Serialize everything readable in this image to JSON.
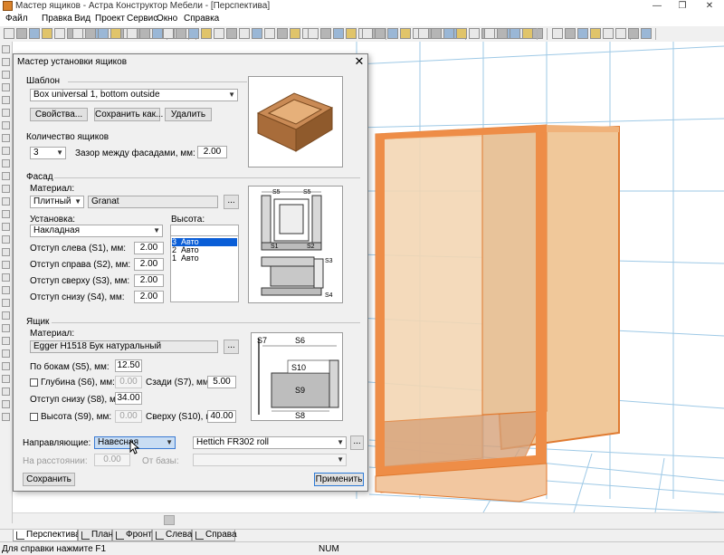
{
  "window": {
    "title": "Мастер ящиков - Астра Конструктор Мебели - [Перспектива]"
  },
  "menu": [
    "Файл",
    "Правка",
    "Вид",
    "Проект",
    "Сервис",
    "Окно",
    "Справка"
  ],
  "dialog": {
    "title": "Мастер установки ящиков",
    "template": {
      "section": "Шаблон",
      "selected": "Box universal 1, bottom outside",
      "properties_btn": "Свойства...",
      "save_as_btn": "Сохранить как...",
      "delete_btn": "Удалить"
    },
    "count": {
      "section": "Количество ящиков",
      "value": "3",
      "gap_label": "Зазор между фасадами, мм:",
      "gap_value": "2.00"
    },
    "facade": {
      "section": "Фасад",
      "material_label": "Материал:",
      "material_type": "Плитный",
      "material_name": "Granat",
      "mount_label": "Установка:",
      "mount_value": "Накладная",
      "height_label": "Высота:",
      "heights": [
        {
          "num": "3",
          "value": "Авто"
        },
        {
          "num": "2",
          "value": "Авто"
        },
        {
          "num": "1",
          "value": "Авто"
        }
      ],
      "s1_label": "Отступ слева (S1), мм:",
      "s1_value": "2.00",
      "s2_label": "Отступ справа (S2), мм:",
      "s2_value": "2.00",
      "s3_label": "Отступ сверху (S3), мм:",
      "s3_value": "2.00",
      "s4_label": "Отступ снизу (S4), мм:",
      "s4_value": "2.00",
      "diagram": {
        "s5a": "S5",
        "s5b": "S5",
        "s1": "S1",
        "s2": "S2",
        "s3": "S3",
        "s4": "S4"
      }
    },
    "box": {
      "section": "Ящик",
      "material_label": "Материал:",
      "material_value": "Egger H1518 Бук натуральный",
      "s5_label": "По бокам (S5), мм:",
      "s5_value": "12.50",
      "s6_label": "Глубина (S6), мм:",
      "s6_value": "0.00",
      "s7_label": "Сзади (S7), мм:",
      "s7_value": "5.00",
      "s8_label": "Отступ снизу (S8), мм:",
      "s8_value": "34.00",
      "s9_label": "Высота (S9), мм:",
      "s9_value": "0.00",
      "s10_label": "Сверху (S10), мм:",
      "s10_value": "40.00",
      "diagram": {
        "s7": "S7",
        "s6": "S6",
        "s10": "S10",
        "s9": "S9",
        "s8": "S8"
      }
    },
    "guides": {
      "label": "Направляющие:",
      "type": "Навесная",
      "model": "Hettich FR302 roll",
      "distance_label": "На расстоянии:",
      "distance_value": "0.00",
      "from_base_label": "От базы:"
    },
    "save_btn": "Сохранить",
    "apply_btn": "Применить",
    "browse": "..."
  },
  "tabs": [
    "Перспектива",
    "План",
    "Фронт",
    "Слева",
    "Справа"
  ],
  "status": {
    "hint": "Для справки нажмите F1",
    "num": "NUM"
  },
  "colors": {
    "wood": "#e8a66c",
    "edge": "#e07a30",
    "selection": "#0a5ed7",
    "grid": "#9ec9e6"
  }
}
